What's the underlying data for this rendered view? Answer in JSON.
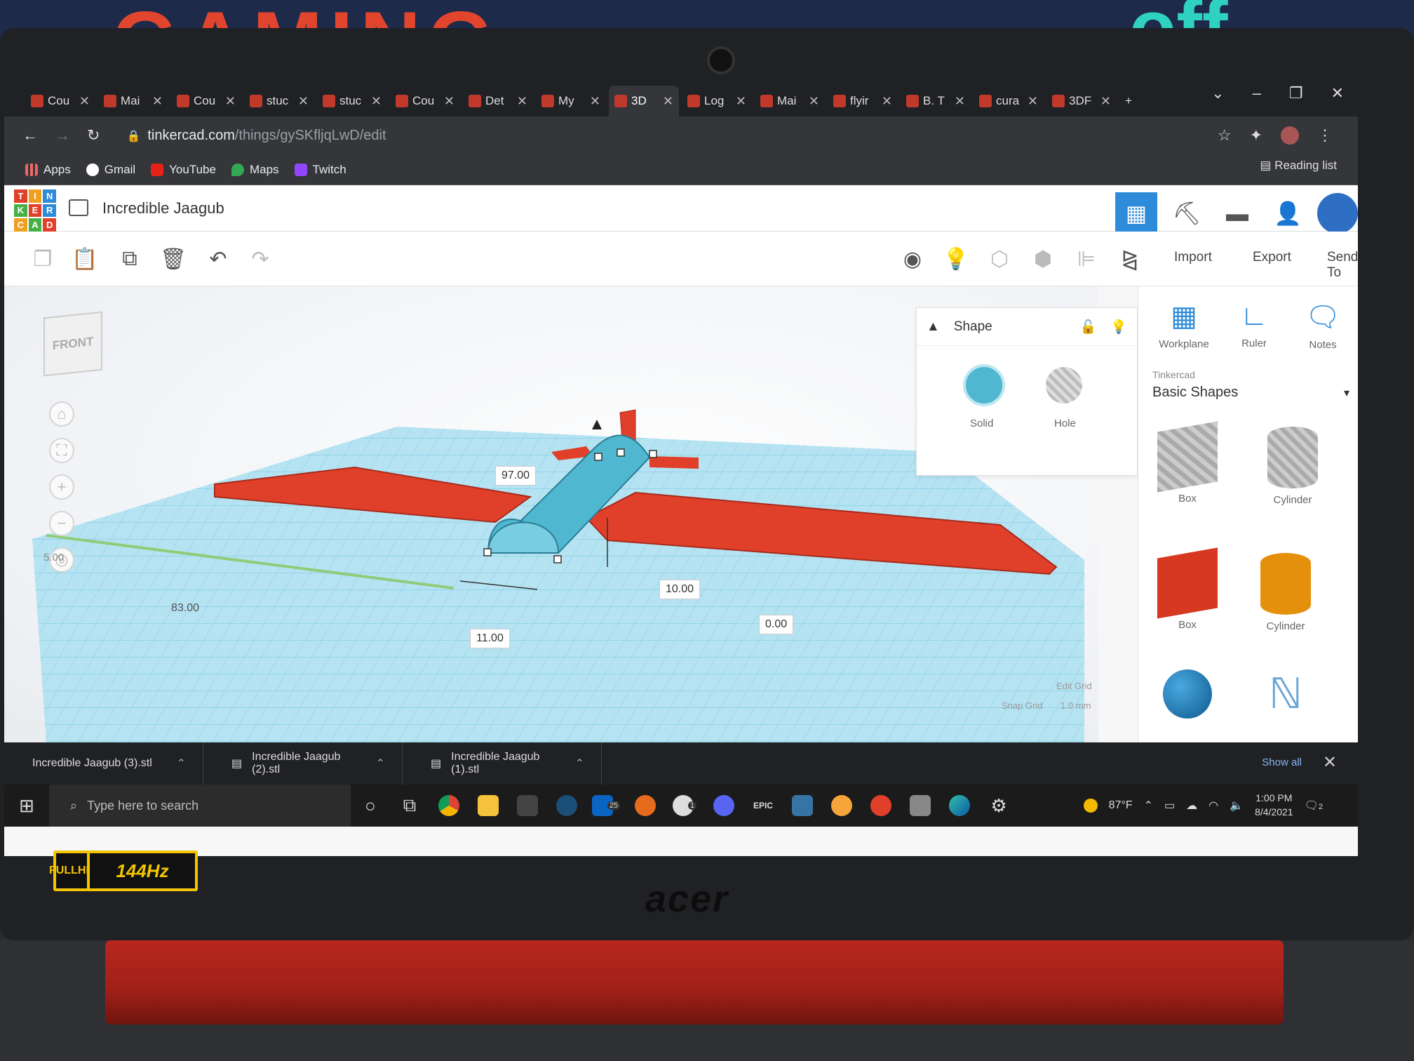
{
  "wall": {
    "sign_left": "GAMING",
    "sign_right": "off"
  },
  "browser": {
    "tabs": [
      {
        "label": "Cou",
        "active": false
      },
      {
        "label": "Mai",
        "active": false
      },
      {
        "label": "Cou",
        "active": false
      },
      {
        "label": "stuc",
        "active": false
      },
      {
        "label": "stuc",
        "active": false
      },
      {
        "label": "Cou",
        "active": false
      },
      {
        "label": "Det",
        "active": false
      },
      {
        "label": "My",
        "active": false
      },
      {
        "label": "3D",
        "active": true
      },
      {
        "label": "Log",
        "active": false
      },
      {
        "label": "Mai",
        "active": false
      },
      {
        "label": "flyir",
        "active": false
      },
      {
        "label": "B. T",
        "active": false
      },
      {
        "label": "cura",
        "active": false
      },
      {
        "label": "3DF",
        "active": false
      }
    ],
    "url_host": "tinkercad.com",
    "url_path": "/things/gySKfljqLwD/edit",
    "bookmarks": [
      "Apps",
      "Gmail",
      "YouTube",
      "Maps",
      "Twitch"
    ],
    "reading_list": "Reading list"
  },
  "tinkercad": {
    "logo_letters": [
      "T",
      "I",
      "N",
      "K",
      "E",
      "R",
      "C",
      "A",
      "D"
    ],
    "design_title": "Incredible Jaagub",
    "toolbar_text_buttons": {
      "import": "Import",
      "export": "Export",
      "send_to": "Send To"
    },
    "viewcube_label": "FRONT",
    "dimensions": {
      "length": "97.00",
      "side": "83.00",
      "width": "11.00",
      "height": "10.00",
      "elevation": "0.00",
      "scale_hint": "5.00"
    },
    "grid": {
      "edit_grid": "Edit Grid",
      "snap_grid_label": "Snap Grid",
      "snap_grid_value": "1.0 mm"
    },
    "inspector": {
      "title": "Shape",
      "solid_label": "Solid",
      "hole_label": "Hole",
      "solid_color": "#4fb8d0"
    },
    "panel": {
      "tools": [
        "Workplane",
        "Ruler",
        "Notes"
      ],
      "library_source": "Tinkercad",
      "library_name": "Basic Shapes",
      "shapes": [
        {
          "label": "Box",
          "kind": "hole-box"
        },
        {
          "label": "Cylinder",
          "kind": "hole-cylinder"
        },
        {
          "label": "Box",
          "kind": "box"
        },
        {
          "label": "Cylinder",
          "kind": "cylinder"
        },
        {
          "label": "",
          "kind": "sphere"
        },
        {
          "label": "",
          "kind": "scribble"
        }
      ]
    },
    "colors": {
      "accent": "#2e8bd9",
      "wing": "#e0402a",
      "fuselage": "#4fb8d0",
      "grid": "#6cc7e6"
    }
  },
  "downloads": {
    "files": [
      "Incredible Jaagub (3).stl",
      "Incredible Jaagub (2).stl",
      "Incredible Jaagub (1).stl"
    ],
    "show_all": "Show all"
  },
  "taskbar": {
    "search_placeholder": "Type here to search",
    "mail_badge": "25",
    "xbox_badge": "1",
    "epic_label": "EPIC",
    "temperature": "87°F",
    "time": "1:00 PM",
    "date": "8/4/2021",
    "notif_count": "2"
  },
  "laptop": {
    "sticker_top": "FULL",
    "sticker_bottom": "HD",
    "refresh": "144Hz",
    "brand": "acer"
  }
}
